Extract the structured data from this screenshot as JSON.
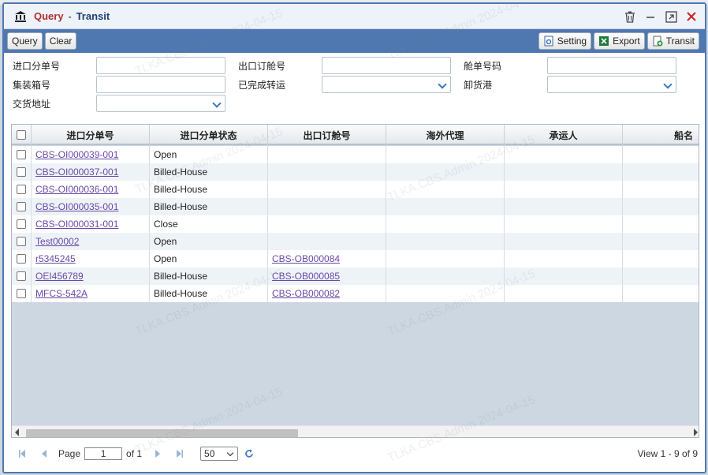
{
  "window": {
    "title_module": "Query",
    "title_separator": "-",
    "title_page": "Transit"
  },
  "icons": {
    "app": "bank-icon",
    "trash": "trash-icon",
    "minimize": "minimize-icon",
    "maximize": "maximize-icon",
    "close": "close-icon"
  },
  "toolbar": {
    "query_label": "Query",
    "clear_label": "Clear",
    "setting_label": "Setting",
    "export_label": "Export",
    "transit_label": "Transit"
  },
  "form": {
    "import_sub_no": "进口分单号",
    "export_booking_no": "出口订舱号",
    "booking_no": "舱单号码",
    "container_no": "集装箱号",
    "transit_done": "已完成转运",
    "discharge_port": "卸货港",
    "delivery_address": "交货地址"
  },
  "grid": {
    "headers": [
      "进口分单号",
      "进口分单状态",
      "出口订舱号",
      "海外代理",
      "承运人",
      "船名"
    ],
    "rows": [
      {
        "sub_no": "CBS-OI000039-001",
        "status": "Open",
        "booking": "",
        "agent": "",
        "carrier": "",
        "vessel": ""
      },
      {
        "sub_no": "CBS-OI000037-001",
        "status": "Billed-House",
        "booking": "",
        "agent": "",
        "carrier": "",
        "vessel": ""
      },
      {
        "sub_no": "CBS-OI000036-001",
        "status": "Billed-House",
        "booking": "",
        "agent": "",
        "carrier": "",
        "vessel": ""
      },
      {
        "sub_no": "CBS-OI000035-001",
        "status": "Billed-House",
        "booking": "",
        "agent": "",
        "carrier": "",
        "vessel": ""
      },
      {
        "sub_no": "CBS-OI000031-001",
        "status": "Close",
        "booking": "",
        "agent": "",
        "carrier": "",
        "vessel": ""
      },
      {
        "sub_no": "Test00002",
        "status": "Open",
        "booking": "",
        "agent": "",
        "carrier": "",
        "vessel": ""
      },
      {
        "sub_no": "r5345245",
        "status": "Open",
        "booking": "CBS-OB000084",
        "agent": "",
        "carrier": "",
        "vessel": ""
      },
      {
        "sub_no": "OEI456789",
        "status": "Billed-House",
        "booking": "CBS-OB000085",
        "agent": "",
        "carrier": "",
        "vessel": ""
      },
      {
        "sub_no": "MFCS-542A",
        "status": "Billed-House",
        "booking": "CBS-OB000082",
        "agent": "",
        "carrier": "",
        "vessel": ""
      }
    ]
  },
  "pager": {
    "page_label": "Page",
    "page_value": "1",
    "of_label": "of 1",
    "page_size": "50",
    "view_text": "View 1 - 9 of 9"
  },
  "watermark": "TLKA.CBS.Admin 2024-04-15",
  "colors": {
    "toolbar_bg": "#4f78b0",
    "title_module": "#b03030",
    "title_page": "#1f3f73",
    "link": "#6a4aa8",
    "close_icon": "#d02020"
  }
}
